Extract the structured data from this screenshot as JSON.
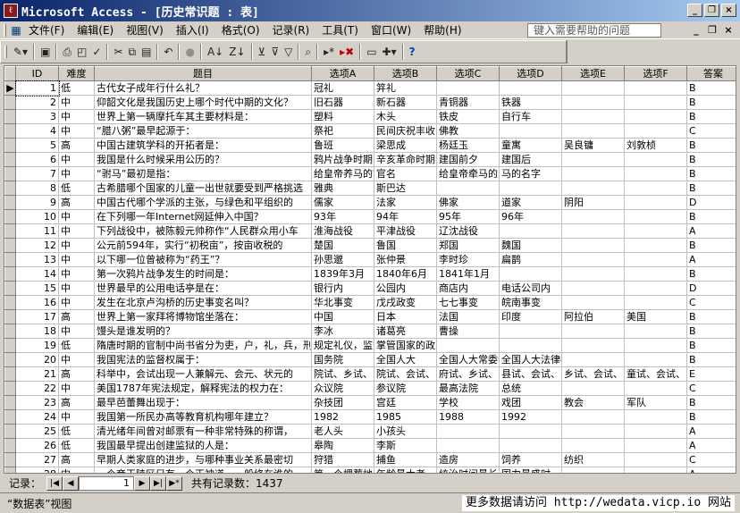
{
  "window": {
    "title": "Microsoft Access - [历史常识题 : 表]",
    "minimize": "_",
    "restore": "❐",
    "close": "×"
  },
  "menu": {
    "items": [
      "文件(F)",
      "编辑(E)",
      "视图(V)",
      "插入(I)",
      "格式(O)",
      "记录(R)",
      "工具(T)",
      "窗口(W)",
      "帮助(H)"
    ],
    "help_placeholder": "键入需要帮助的问题",
    "mdi_min": "_",
    "mdi_restore": "❐",
    "mdi_close": "×"
  },
  "toolbar": {
    "design": "✎▾",
    "save": "▣",
    "print": "⎙",
    "preview": "◰",
    "spell": "✓",
    "cut": "✂",
    "copy": "⧉",
    "paste": "▤",
    "undo": "↶",
    "hyperlink": "●",
    "sort_asc": "A↓",
    "sort_desc": "Z↓",
    "filter_sel": "⊻",
    "filter_form": "⊽",
    "filter_apply": "▽",
    "find": "⌕",
    "new_record": "▸*",
    "delete_record": "▸✖",
    "db_window": "▭",
    "new_object": "✚▾",
    "help": "?"
  },
  "table": {
    "headers": [
      "ID",
      "难度",
      "题目",
      "选项A",
      "选项B",
      "选项C",
      "选项D",
      "选项E",
      "选项F",
      "答案"
    ],
    "rows": [
      {
        "id": "1",
        "diff": "低",
        "q": "古代女子成年行什么礼？",
        "a": "冠礼",
        "b": "笄礼",
        "c": "",
        "d": "",
        "e": "",
        "f": "",
        "ans": "B"
      },
      {
        "id": "2",
        "diff": "中",
        "q": "仰韶文化是我国历史上哪个时代中期的文化？",
        "a": "旧石器",
        "b": "新石器",
        "c": "青铜器",
        "d": "铁器",
        "e": "",
        "f": "",
        "ans": "B"
      },
      {
        "id": "3",
        "diff": "中",
        "q": "世界上第一辆摩托车其主要材料是：",
        "a": "塑料",
        "b": "木头",
        "c": "铁皮",
        "d": "自行车",
        "e": "",
        "f": "",
        "ans": "B"
      },
      {
        "id": "4",
        "diff": "中",
        "q": "“腊八粥”最早起源于：",
        "a": "祭祀",
        "b": "民间庆祝丰收",
        "c": "佛教",
        "d": "",
        "e": "",
        "f": "",
        "ans": "C"
      },
      {
        "id": "5",
        "diff": "高",
        "q": "中国古建筑学科的开拓者是：",
        "a": "鲁班",
        "b": "梁思成",
        "c": "杨廷玉",
        "d": "童寓",
        "e": "吴良镛",
        "f": "刘敦桢",
        "ans": "B"
      },
      {
        "id": "6",
        "diff": "中",
        "q": "我国是什么时候采用公历的？",
        "a": "鸦片战争时期",
        "b": "辛亥革命时期",
        "c": "建国前夕",
        "d": "建国后",
        "e": "",
        "f": "",
        "ans": "B"
      },
      {
        "id": "7",
        "diff": "中",
        "q": "“驸马”最初是指：",
        "a": "给皇帝养马的官",
        "b": "官名",
        "c": "给皇帝牵马的人",
        "d": "马的名字",
        "e": "",
        "f": "",
        "ans": "B"
      },
      {
        "id": "8",
        "diff": "低",
        "q": "古希腊哪个国家的儿童一出世就要受到严格挑选",
        "a": "雅典",
        "b": "斯巴达",
        "c": "",
        "d": "",
        "e": "",
        "f": "",
        "ans": "B"
      },
      {
        "id": "9",
        "diff": "高",
        "q": "中国古代哪个学派的主张，与绿色和平组织的",
        "a": "儒家",
        "b": "法家",
        "c": "佛家",
        "d": "道家",
        "e": "阴阳",
        "f": "",
        "ans": "D"
      },
      {
        "id": "10",
        "diff": "中",
        "q": "在下列哪一年Internet网延伸入中国？",
        "a": "93年",
        "b": "94年",
        "c": "95年",
        "d": "96年",
        "e": "",
        "f": "",
        "ans": "B"
      },
      {
        "id": "11",
        "diff": "中",
        "q": "下列战役中，被陈毅元帅称作“人民群众用小车",
        "a": "淮海战役",
        "b": "平津战役",
        "c": "辽沈战役",
        "d": "",
        "e": "",
        "f": "",
        "ans": "A"
      },
      {
        "id": "12",
        "diff": "中",
        "q": "公元前594年，实行“初税亩”，按亩收税的",
        "a": "楚国",
        "b": "鲁国",
        "c": "郑国",
        "d": "魏国",
        "e": "",
        "f": "",
        "ans": "B"
      },
      {
        "id": "13",
        "diff": "中",
        "q": "以下哪一位曾被称为“药王”？",
        "a": "孙思邈",
        "b": "张仲景",
        "c": "李时珍",
        "d": "扁鹊",
        "e": "",
        "f": "",
        "ans": "A"
      },
      {
        "id": "14",
        "diff": "中",
        "q": "第一次鸦片战争发生的时间是：",
        "a": "1839年3月",
        "b": "1840年6月",
        "c": "1841年1月",
        "d": "",
        "e": "",
        "f": "",
        "ans": "B"
      },
      {
        "id": "15",
        "diff": "中",
        "q": "世界最早的公用电话亭是在：",
        "a": "银行内",
        "b": "公园内",
        "c": "商店内",
        "d": "电话公司内",
        "e": "",
        "f": "",
        "ans": "D"
      },
      {
        "id": "16",
        "diff": "中",
        "q": "发生在北京卢沟桥的历史事变名叫？",
        "a": "华北事变",
        "b": "戊戌政变",
        "c": "七七事变",
        "d": "皖南事变",
        "e": "",
        "f": "",
        "ans": "C"
      },
      {
        "id": "17",
        "diff": "高",
        "q": "世界上第一家拜将博物馆坐落在：",
        "a": "中国",
        "b": "日本",
        "c": "法国",
        "d": "印度",
        "e": "阿拉伯",
        "f": "美国",
        "ans": "B"
      },
      {
        "id": "18",
        "diff": "中",
        "q": "馒头是谁发明的？",
        "a": "李冰",
        "b": "诸葛亮",
        "c": "曹操",
        "d": "",
        "e": "",
        "f": "",
        "ans": "B"
      },
      {
        "id": "19",
        "diff": "低",
        "q": "隋唐时期的官制中尚书省分为吏，户，礼，兵，刑",
        "a": "规定礼仪，监督",
        "b": "掌管国家的政",
        "c": "",
        "d": "",
        "e": "",
        "f": "",
        "ans": "B"
      },
      {
        "id": "20",
        "diff": "中",
        "q": "我国宪法的监督权属于：",
        "a": "国务院",
        "b": "全国人大",
        "c": "全国人大常委会",
        "d": "全国人大法律委",
        "e": "",
        "f": "",
        "ans": "B"
      },
      {
        "id": "21",
        "diff": "高",
        "q": "科举中，会试出现一人兼解元、会元、状元的",
        "a": "院试、乡试、",
        "b": "院试、会试、",
        "c": "府试、乡试、",
        "d": "县试、会试、",
        "e": "乡试、会试、",
        "f": "童试、会试、",
        "ans": "E"
      },
      {
        "id": "22",
        "diff": "中",
        "q": "美国1787年宪法规定，解释宪法的权力在：",
        "a": "众议院",
        "b": "参议院",
        "c": "最高法院",
        "d": "总统",
        "e": "",
        "f": "",
        "ans": "C"
      },
      {
        "id": "23",
        "diff": "高",
        "q": "最早芭蕾舞出现于：",
        "a": "杂技团",
        "b": "宫廷",
        "c": "学校",
        "d": "戏团",
        "e": "教会",
        "f": "军队",
        "ans": "B"
      },
      {
        "id": "24",
        "diff": "中",
        "q": "我国第一所民办高等教育机构哪年建立？",
        "a": "1982",
        "b": "1985",
        "c": "1988",
        "d": "1992",
        "e": "",
        "f": "",
        "ans": "B"
      },
      {
        "id": "25",
        "diff": "低",
        "q": "清光绪年间曾对邮票有一种非常特殊的称谓，",
        "a": "老人头",
        "b": "小孩头",
        "c": "",
        "d": "",
        "e": "",
        "f": "",
        "ans": "A"
      },
      {
        "id": "26",
        "diff": "低",
        "q": "我国最早提出创建监狱的人是：",
        "a": "皋陶",
        "b": "李斯",
        "c": "",
        "d": "",
        "e": "",
        "f": "",
        "ans": "A"
      },
      {
        "id": "27",
        "diff": "高",
        "q": "早期人类家庭的进步，与哪种事业关系最密切",
        "a": "狩猎",
        "b": "捕鱼",
        "c": "造房",
        "d": "饲养",
        "e": "纺织",
        "f": "",
        "ans": "C"
      },
      {
        "id": "28",
        "diff": "中",
        "q": "一个帝王陵区只有一个正神道，一般修在谁的",
        "a": "第一个埋葬地",
        "b": "年龄最大者",
        "c": "统治时间最长",
        "d": "国力最盛时",
        "e": "",
        "f": "",
        "ans": "A"
      }
    ]
  },
  "nav": {
    "label": "记录：",
    "first": "|◀",
    "prev": "◀",
    "position": "1",
    "next": "▶",
    "last": "▶|",
    "new": "▶*",
    "total": "共有记录数：1437"
  },
  "status": {
    "text": "“数据表”视图",
    "watermark": "更多数据请访问 http://wedata.vicp.io 网站"
  }
}
